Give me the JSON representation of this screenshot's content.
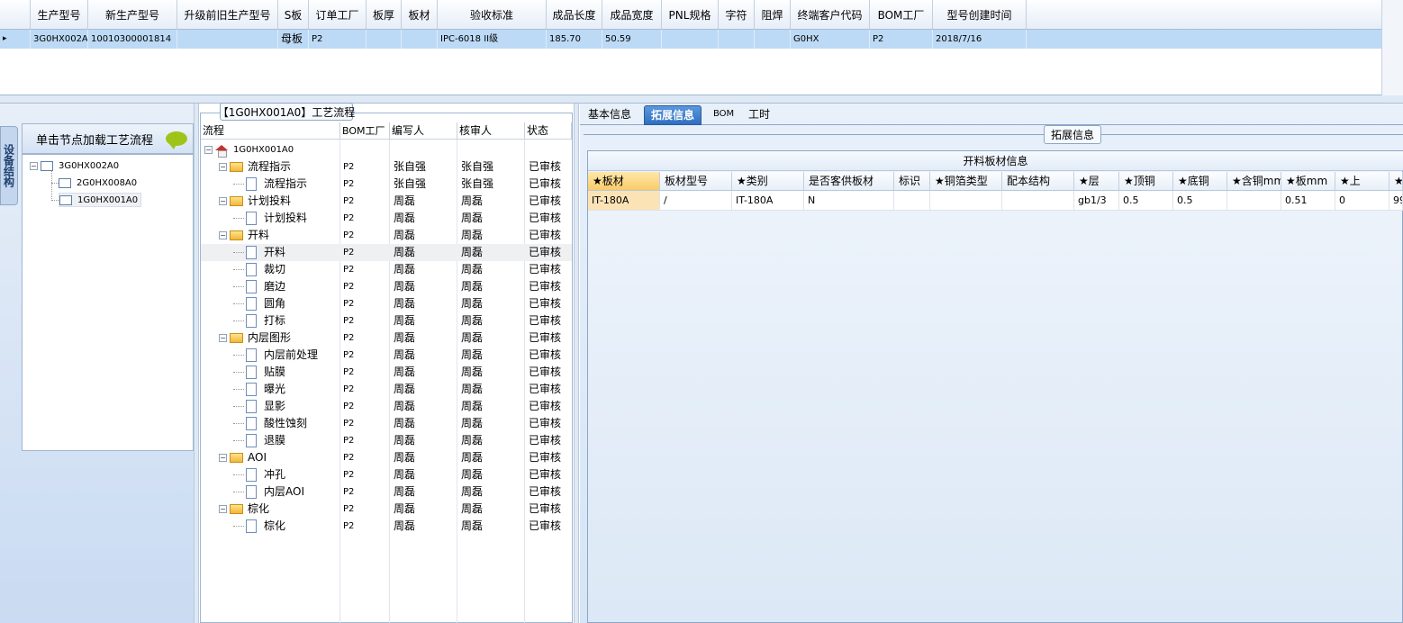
{
  "top_grid": {
    "columns": [
      "生产型号",
      "新生产型号",
      "升级前旧生产型号",
      "S板",
      "订单工厂",
      "板厚",
      "板材",
      "验收标准",
      "成品长度",
      "成品宽度",
      "PNL规格",
      "字符",
      "阻焊",
      "终端客户代码",
      "BOM工厂",
      "型号创建时间"
    ],
    "row": {
      "row_indicator": "▸",
      "cells": [
        "3G0HX002A0",
        "10010300001814",
        "",
        "母板",
        "P2",
        "",
        "",
        "IPC-6018 II级",
        "185.70",
        "50.59",
        "",
        "",
        "",
        "G0HX",
        "P2",
        "2018/7/16"
      ]
    }
  },
  "left_panel": {
    "vertical_tab": "设备结构",
    "load_header": "单击节点加载工艺流程",
    "tree": [
      {
        "label": "3G0HX002A0",
        "toggle": "−"
      },
      {
        "label": "2G0HX008A0"
      },
      {
        "label": "1G0HX001A0"
      }
    ]
  },
  "middle_panel": {
    "title": "【1G0HX001A0】工艺流程",
    "columns": [
      "流程",
      "BOM工厂",
      "编写人",
      "核审人",
      "状态"
    ],
    "rows": [
      {
        "label": "1G0HX001A0",
        "type": "root",
        "level": 0,
        "toggle": "−",
        "factory": "",
        "writer": "",
        "reviewer": "",
        "status": ""
      },
      {
        "label": "流程指示",
        "type": "folder",
        "level": 1,
        "toggle": "−",
        "factory": "P2",
        "writer": "张自强",
        "reviewer": "张自强",
        "status": "已审核"
      },
      {
        "label": "流程指示",
        "type": "doc",
        "level": 2,
        "factory": "P2",
        "writer": "张自强",
        "reviewer": "张自强",
        "status": "已审核"
      },
      {
        "label": "计划投料",
        "type": "folder",
        "level": 1,
        "toggle": "−",
        "factory": "P2",
        "writer": "周磊",
        "reviewer": "周磊",
        "status": "已审核"
      },
      {
        "label": "计划投料",
        "type": "doc",
        "level": 2,
        "factory": "P2",
        "writer": "周磊",
        "reviewer": "周磊",
        "status": "已审核"
      },
      {
        "label": "开料",
        "type": "folder",
        "level": 1,
        "toggle": "−",
        "factory": "P2",
        "writer": "周磊",
        "reviewer": "周磊",
        "status": "已审核"
      },
      {
        "label": "开料",
        "type": "doc",
        "level": 2,
        "selected": true,
        "factory": "P2",
        "writer": "周磊",
        "reviewer": "周磊",
        "status": "已审核"
      },
      {
        "label": "裁切",
        "type": "doc",
        "level": 2,
        "factory": "P2",
        "writer": "周磊",
        "reviewer": "周磊",
        "status": "已审核"
      },
      {
        "label": "磨边",
        "type": "doc",
        "level": 2,
        "factory": "P2",
        "writer": "周磊",
        "reviewer": "周磊",
        "status": "已审核"
      },
      {
        "label": "圆角",
        "type": "doc",
        "level": 2,
        "factory": "P2",
        "writer": "周磊",
        "reviewer": "周磊",
        "status": "已审核"
      },
      {
        "label": "打标",
        "type": "doc",
        "level": 2,
        "factory": "P2",
        "writer": "周磊",
        "reviewer": "周磊",
        "status": "已审核"
      },
      {
        "label": "内层图形",
        "type": "folder",
        "level": 1,
        "toggle": "−",
        "factory": "P2",
        "writer": "周磊",
        "reviewer": "周磊",
        "status": "已审核"
      },
      {
        "label": "内层前处理",
        "type": "doc",
        "level": 2,
        "factory": "P2",
        "writer": "周磊",
        "reviewer": "周磊",
        "status": "已审核"
      },
      {
        "label": "贴膜",
        "type": "doc",
        "level": 2,
        "factory": "P2",
        "writer": "周磊",
        "reviewer": "周磊",
        "status": "已审核"
      },
      {
        "label": "曝光",
        "type": "doc",
        "level": 2,
        "factory": "P2",
        "writer": "周磊",
        "reviewer": "周磊",
        "status": "已审核"
      },
      {
        "label": "显影",
        "type": "doc",
        "level": 2,
        "factory": "P2",
        "writer": "周磊",
        "reviewer": "周磊",
        "status": "已审核"
      },
      {
        "label": "酸性蚀刻",
        "type": "doc",
        "level": 2,
        "factory": "P2",
        "writer": "周磊",
        "reviewer": "周磊",
        "status": "已审核"
      },
      {
        "label": "退膜",
        "type": "doc",
        "level": 2,
        "factory": "P2",
        "writer": "周磊",
        "reviewer": "周磊",
        "status": "已审核"
      },
      {
        "label": "AOI",
        "type": "folder",
        "level": 1,
        "toggle": "−",
        "factory": "P2",
        "writer": "周磊",
        "reviewer": "周磊",
        "status": "已审核"
      },
      {
        "label": "冲孔",
        "type": "doc",
        "level": 2,
        "factory": "P2",
        "writer": "周磊",
        "reviewer": "周磊",
        "status": "已审核"
      },
      {
        "label": "内层AOI",
        "type": "doc",
        "level": 2,
        "factory": "P2",
        "writer": "周磊",
        "reviewer": "周磊",
        "status": "已审核"
      },
      {
        "label": "棕化",
        "type": "folder",
        "level": 1,
        "toggle": "−",
        "factory": "P2",
        "writer": "周磊",
        "reviewer": "周磊",
        "status": "已审核"
      },
      {
        "label": "棕化",
        "type": "doc",
        "level": 2,
        "factory": "P2",
        "writer": "周磊",
        "reviewer": "周磊",
        "status": "已审核"
      }
    ]
  },
  "right_panel": {
    "tabs": [
      {
        "label": "基本信息",
        "active": false
      },
      {
        "label": "拓展信息",
        "active": true
      },
      {
        "label": "BOM",
        "active": false
      },
      {
        "label": "工时",
        "active": false
      }
    ],
    "group_label": "拓展信息",
    "grid_caption": "开料板材信息",
    "columns": [
      "★板材",
      "板材型号",
      "★类别",
      "是否客供板材",
      "标识",
      "★铜箔类型",
      "配本结构",
      "★层",
      "★顶铜",
      "★底铜",
      "★含铜mm",
      "★板mm",
      "★上",
      "★"
    ],
    "row": [
      "IT-180A",
      "/",
      "IT-180A",
      "N",
      "",
      "",
      "",
      "gb1/3",
      "0.5",
      "0.5",
      "",
      "0.51",
      "0",
      "99"
    ]
  },
  "colors": {
    "selection": "#bcdaf6",
    "active_tab": "#2f6fc0",
    "active_header": "#f9cc6a"
  }
}
